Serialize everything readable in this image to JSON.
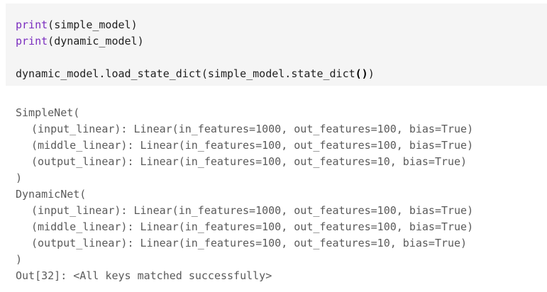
{
  "code_cell": {
    "lines": [
      {
        "fn": "print",
        "arg": "simple_model"
      },
      {
        "fn": "print",
        "arg": "dynamic_model"
      }
    ],
    "load_line": {
      "prefix": "dynamic_model.load_state_dict(simple_model.state_dict",
      "inner_parens": "()",
      "suffix": ")"
    }
  },
  "output": {
    "simple_open": "SimpleNet(",
    "simple_layers": [
      "(input_linear): Linear(in_features=1000, out_features=100, bias=True)",
      "(middle_linear): Linear(in_features=100, out_features=100, bias=True)",
      "(output_linear): Linear(in_features=100, out_features=10, bias=True)"
    ],
    "simple_close": ")",
    "dynamic_open": "DynamicNet(",
    "dynamic_layers": [
      "(input_linear): Linear(in_features=1000, out_features=100, bias=True)",
      "(middle_linear): Linear(in_features=100, out_features=100, bias=True)",
      "(output_linear): Linear(in_features=100, out_features=10, bias=True)"
    ],
    "dynamic_close": ")",
    "result": "Out[32]: <All keys matched successfully>"
  }
}
